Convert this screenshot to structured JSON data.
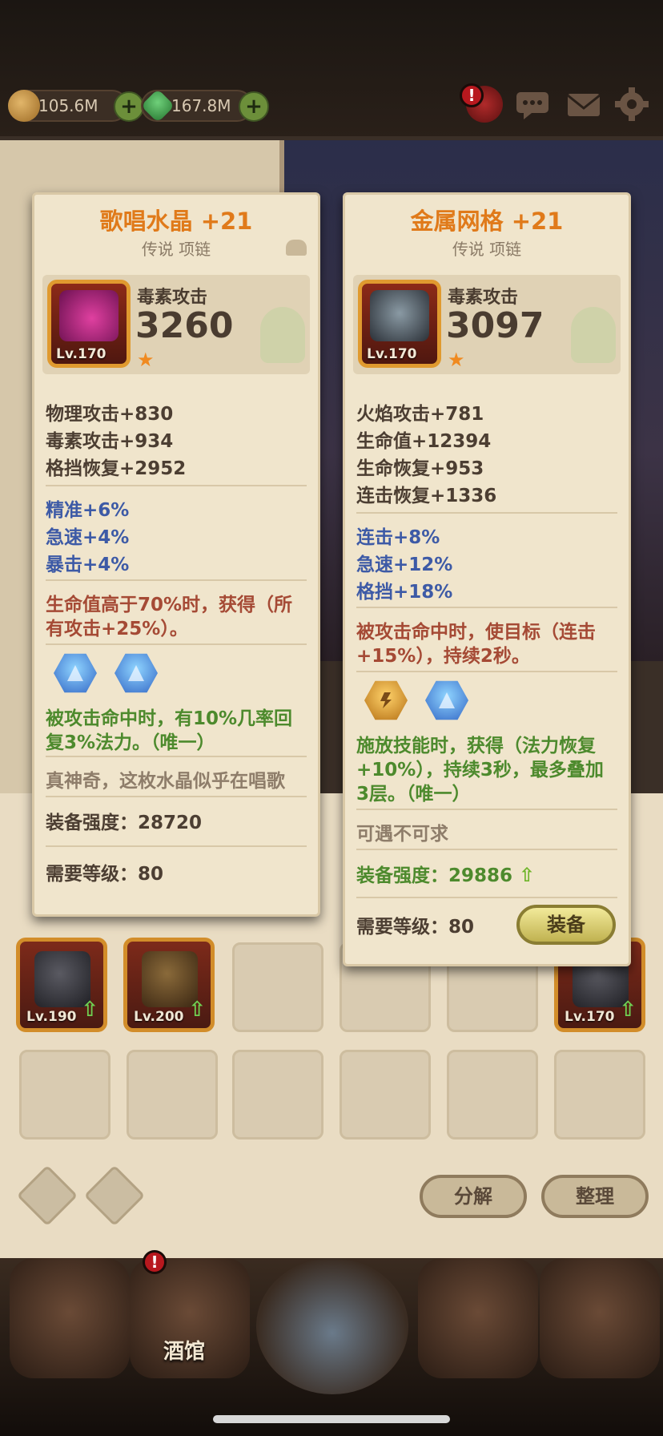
{
  "currency": {
    "gold": "105.6M",
    "gems": "167.8M",
    "plus": "+"
  },
  "alerts": {
    "mark": "!"
  },
  "card_left": {
    "title": "歌唱水晶 +21",
    "subtitle": "传说 项链",
    "level": "Lv.170",
    "main_stat_name": "毒素攻击",
    "main_stat_value": "3260",
    "star": "★",
    "base_stats": [
      "物理攻击+830",
      "毒素攻击+934",
      "格挡恢复+2952"
    ],
    "bonus_stats": [
      "精准+6%",
      "急速+4%",
      "暴击+4%"
    ],
    "passive_lines": [
      "生命值高于70%时，获得（所",
      "有攻击+25%）。"
    ],
    "socket_effect_lines": [
      "被攻击命中时，有10%几率回",
      "复3%法力。（唯一）"
    ],
    "flavor": "真神奇，这枚水晶似乎在唱歌",
    "power": "装备强度：28720",
    "required_level": "需要等级：80"
  },
  "card_right": {
    "title": "金属网格 +21",
    "subtitle": "传说 项链",
    "level": "Lv.170",
    "main_stat_name": "毒素攻击",
    "main_stat_value": "3097",
    "star": "★",
    "base_stats": [
      "火焰攻击+781",
      "生命值+12394",
      "生命恢复+953",
      "连击恢复+1336"
    ],
    "bonus_stats": [
      "连击+8%",
      "急速+12%",
      "格挡+18%"
    ],
    "passive_lines": [
      "被攻击命中时，使目标（连击",
      "+15%），持续2秒。"
    ],
    "socket_effect_lines": [
      "施放技能时，获得（法力恢复",
      "+10%），持续3秒，最多叠加",
      "3层。（唯一）"
    ],
    "flavor": "可遇不可求",
    "power_label": "装备强度：",
    "power_value": "29886",
    "power_up": "⇧",
    "required_level": "需要等级：80",
    "equip_button": "装备"
  },
  "bag": {
    "items": [
      {
        "level": "Lv.190",
        "up": "⇧"
      },
      {
        "level": "Lv.200",
        "up": "⇧"
      },
      {
        "level": "Lv.170",
        "up": "⇧"
      }
    ],
    "decompose_button": "分解",
    "sort_button": "整理"
  },
  "nav": {
    "tavern_label": "酒馆"
  }
}
